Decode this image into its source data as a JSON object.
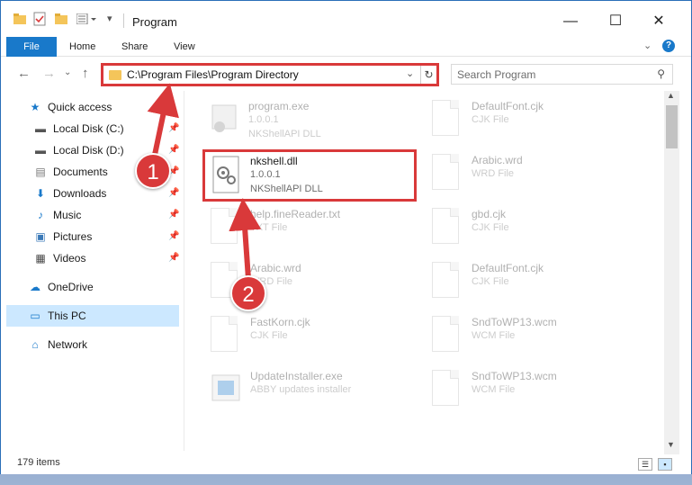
{
  "window": {
    "title": "Program",
    "controls": {
      "minimize": "—",
      "maximize": "☐",
      "close": "✕"
    }
  },
  "ribbon": {
    "tabs": [
      {
        "label": "File"
      },
      {
        "label": "Home"
      },
      {
        "label": "Share"
      },
      {
        "label": "View"
      }
    ],
    "expand_icon": "chevron-down-icon",
    "help_icon": "help-icon"
  },
  "address": {
    "path": "C:\\Program Files\\Program Directory",
    "refresh_icon": "refresh-icon"
  },
  "search": {
    "placeholder": "Search Program"
  },
  "sidebar": {
    "items": [
      {
        "label": "Quick access",
        "icon": "star-icon",
        "pinned": false
      },
      {
        "label": "Local Disk (C:)",
        "icon": "drive-icon",
        "pinned": true
      },
      {
        "label": "Local Disk (D:)",
        "icon": "drive-icon",
        "pinned": true
      },
      {
        "label": "Documents",
        "icon": "document-icon",
        "pinned": true
      },
      {
        "label": "Downloads",
        "icon": "download-icon",
        "pinned": true
      },
      {
        "label": "Music",
        "icon": "music-icon",
        "pinned": true
      },
      {
        "label": "Pictures",
        "icon": "picture-icon",
        "pinned": true
      },
      {
        "label": "Videos",
        "icon": "video-icon",
        "pinned": true
      },
      {
        "label": "OneDrive",
        "icon": "cloud-icon",
        "pinned": false
      },
      {
        "label": "This PC",
        "icon": "pc-icon",
        "pinned": false,
        "selected": true
      },
      {
        "label": "Network",
        "icon": "network-icon",
        "pinned": false
      }
    ]
  },
  "files": {
    "left": [
      {
        "name": "program.exe",
        "line1": "1.0.0.1",
        "line2": "NKShellAPI DLL",
        "faded": true,
        "icon": "exe-icon"
      },
      {
        "name": "nkshell.dll",
        "line1": "1.0.0.1",
        "line2": "NKShellAPI DLL",
        "faded": false,
        "icon": "gear-file-icon"
      },
      {
        "name": "help.fineReader.txt",
        "line1": "TXT File",
        "line2": "",
        "faded": true,
        "icon": "text-file-icon"
      },
      {
        "name": "Arabic.wrd",
        "line1": "WRD File",
        "line2": "",
        "faded": true,
        "icon": "file-icon"
      },
      {
        "name": "FastKorn.cjk",
        "line1": "CJK File",
        "line2": "",
        "faded": true,
        "icon": "file-icon"
      },
      {
        "name": "UpdateInstaller.exe",
        "line1": "ABBY updates installer",
        "line2": "",
        "faded": true,
        "icon": "installer-icon"
      }
    ],
    "right": [
      {
        "name": "DefaultFont.cjk",
        "line1": "CJK File",
        "line2": "",
        "faded": true,
        "icon": "file-icon"
      },
      {
        "name": "Arabic.wrd",
        "line1": "WRD File",
        "line2": "",
        "faded": true,
        "icon": "file-icon"
      },
      {
        "name": "gbd.cjk",
        "line1": "CJK File",
        "line2": "",
        "faded": true,
        "icon": "file-icon"
      },
      {
        "name": "DefaultFont.cjk",
        "line1": "CJK File",
        "line2": "",
        "faded": true,
        "icon": "file-icon"
      },
      {
        "name": "SndToWP13.wcm",
        "line1": "WCM File",
        "line2": "",
        "faded": true,
        "icon": "file-icon"
      },
      {
        "name": "SndToWP13.wcm",
        "line1": "WCM File",
        "line2": "",
        "faded": true,
        "icon": "file-icon"
      }
    ]
  },
  "status": {
    "count": "179 items"
  },
  "annotations": {
    "step1": "1",
    "step2": "2",
    "color": "#d9393a"
  },
  "colors": {
    "accent": "#1979ca",
    "selection": "#cce8ff",
    "highlight": "#d9393a"
  }
}
